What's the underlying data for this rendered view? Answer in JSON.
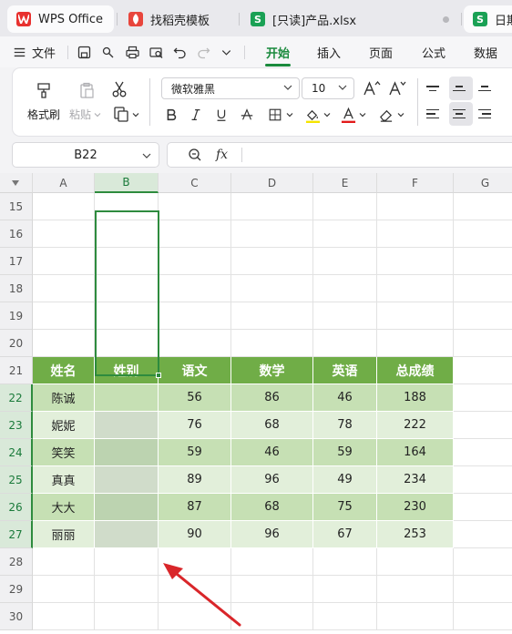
{
  "tabs": [
    {
      "label": "WPS Office",
      "icon": "wps-logo-icon"
    },
    {
      "label": "找稻壳模板",
      "icon": "docer-icon"
    },
    {
      "label": "[只读]产品.xlsx",
      "icon": "spreadsheet-icon",
      "badge": "S"
    },
    {
      "label": "日期",
      "icon": "spreadsheet-icon",
      "badge": "S"
    }
  ],
  "menu": {
    "file_label": "文件",
    "items": [
      "开始",
      "插入",
      "页面",
      "公式",
      "数据"
    ],
    "active": "开始"
  },
  "ribbon": {
    "format_painter_label": "格式刷",
    "paste_label": "粘贴",
    "font_name": "微软雅黑",
    "font_size": "10"
  },
  "formula_bar": {
    "cell_ref": "B22",
    "formula_value": ""
  },
  "sheet": {
    "columns": [
      "A",
      "B",
      "C",
      "D",
      "E",
      "F",
      "G"
    ],
    "selected_column": "B",
    "rows": [
      "15",
      "16",
      "17",
      "18",
      "19",
      "20",
      "21",
      "22",
      "23",
      "24",
      "25",
      "26",
      "27",
      "28",
      "29",
      "30"
    ],
    "selected_rows": [
      "22",
      "23",
      "24",
      "25",
      "26",
      "27"
    ],
    "table_headers": [
      "姓名",
      "姓别",
      "语文",
      "数学",
      "英语",
      "总成绩"
    ],
    "table_rows": [
      [
        "陈诚",
        "",
        "56",
        "86",
        "46",
        "188"
      ],
      [
        "妮妮",
        "",
        "76",
        "68",
        "78",
        "222"
      ],
      [
        "笑笑",
        "",
        "59",
        "46",
        "59",
        "164"
      ],
      [
        "真真",
        "",
        "89",
        "96",
        "49",
        "234"
      ],
      [
        "大大",
        "",
        "87",
        "68",
        "75",
        "230"
      ],
      [
        "丽丽",
        "",
        "90",
        "96",
        "67",
        "253"
      ]
    ]
  },
  "colors": {
    "accent": "#1a8a3d",
    "table_header": "#70ad47",
    "table_row_dark": "#c6e0b4",
    "table_row_light": "#e2efda",
    "arrow": "#d9262a"
  }
}
